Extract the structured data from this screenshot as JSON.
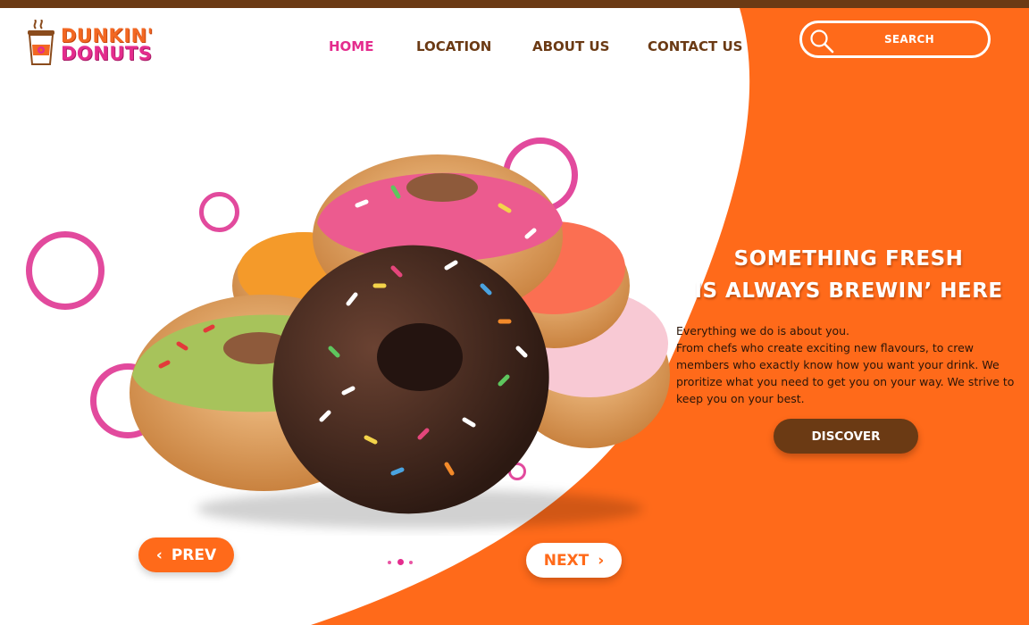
{
  "brand": {
    "line1": "DUNKIN'",
    "line2": "DONUTS",
    "orange": "#ff6a1a",
    "pink": "#e42c8d",
    "brown": "#6b3a14"
  },
  "nav": {
    "items": [
      {
        "label": "HOME",
        "active": true
      },
      {
        "label": "LOCATION",
        "active": false
      },
      {
        "label": "ABOUT US",
        "active": false
      },
      {
        "label": "CONTACT US",
        "active": false
      }
    ]
  },
  "search": {
    "placeholder": "SEARCH",
    "icon": "search-icon"
  },
  "hero": {
    "headline_line1": "SOMETHING FRESH",
    "headline_line2": "IS ALWAYS BREWIN’  HERE",
    "body_lines": [
      "Everything we do is about you.",
      "From chefs who create exciting new flavours, to crew",
      "members who exactly know how you want your drink. We",
      "proritize what you need to get you on your way. We strive to",
      "keep you on your best."
    ],
    "cta_label": "DISCOVER"
  },
  "slider": {
    "prev_label": "PREV",
    "next_label": "NEXT",
    "prev_icon": "chevron-left-icon",
    "next_icon": "chevron-right-icon",
    "slide_count": 3,
    "active_slide": 2
  }
}
